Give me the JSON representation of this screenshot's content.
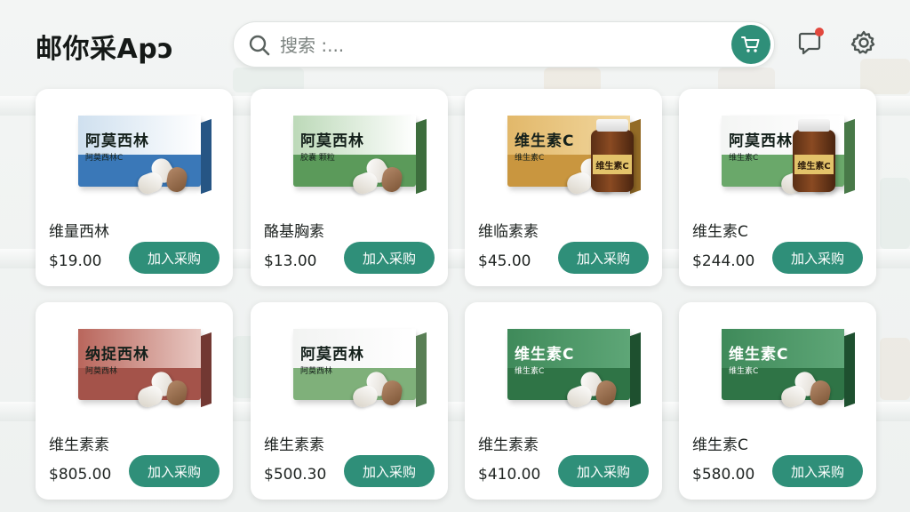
{
  "app": {
    "title": "邮你采Apɔ"
  },
  "search": {
    "placeholder": "搜索 :..."
  },
  "header_icons": {
    "cart": "shopping-cart-icon",
    "notification": "message-icon",
    "settings": "gear-icon"
  },
  "colors": {
    "accent": "#2f8f79",
    "notification_dot": "#e2483d",
    "card_bg": "#ffffff"
  },
  "products": [
    {
      "name": "维量西林",
      "price": "$19.00",
      "button_label": "加入采购",
      "box_title": "阿莫西林",
      "box_sub": "阿莫西林C",
      "box_color": "blue",
      "has_bottle": false
    },
    {
      "name": "酪基胸素",
      "price": "$13.00",
      "button_label": "加入采购",
      "box_title": "阿莫西林",
      "box_sub": "胶囊 颗粒",
      "box_color": "green",
      "has_bottle": false
    },
    {
      "name": "维临素素",
      "price": "$45.00",
      "button_label": "加入采购",
      "box_title": "维生素C",
      "box_sub": "维生素C",
      "box_color": "gold",
      "has_bottle": true
    },
    {
      "name": "维生素C",
      "price": "$244.00",
      "button_label": "加入采购",
      "box_title": "阿莫西林",
      "box_sub": "维生素C",
      "box_color": "white-green",
      "has_bottle": true
    },
    {
      "name": "维生素素",
      "price": "$805.00",
      "button_label": "加入采购",
      "box_title": "纳捉西林",
      "box_sub": "阿莫西林",
      "box_color": "red",
      "has_bottle": false
    },
    {
      "name": "维生素素",
      "price": "$500.30",
      "button_label": "加入采购",
      "box_title": "阿莫西林",
      "box_sub": "阿莫西林",
      "box_color": "white",
      "has_bottle": false
    },
    {
      "name": "维生素素",
      "price": "$410.00",
      "button_label": "加入采购",
      "box_title": "维生素C",
      "box_sub": "维生素C",
      "box_color": "dark-green",
      "has_bottle": false
    },
    {
      "name": "维生素C",
      "price": "$580.00",
      "button_label": "加入采购",
      "box_title": "维生素C",
      "box_sub": "维生素C",
      "box_color": "dark-green",
      "has_bottle": false
    }
  ]
}
